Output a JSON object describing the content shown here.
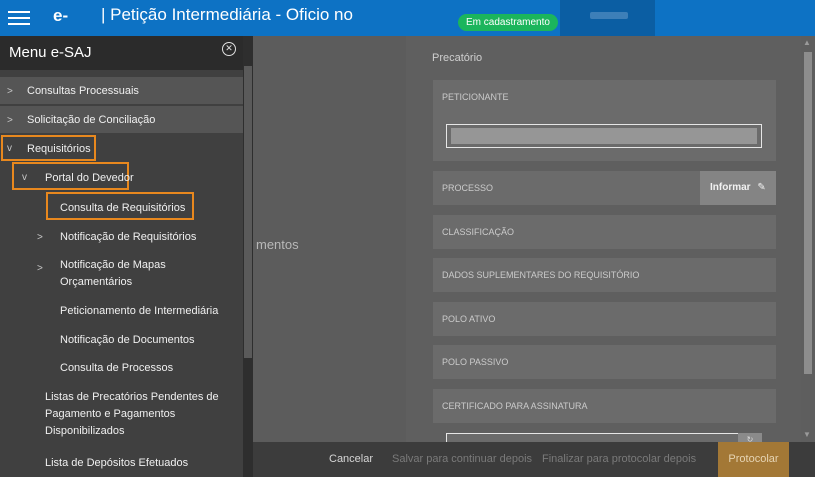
{
  "topbar": {
    "brand": "e-",
    "title": "| Petição Intermediária - Oficio no",
    "status_badge": "Em cadastramento"
  },
  "main": {
    "ghost_text": "mentos",
    "panel": {
      "title": "Precatório",
      "fields": {
        "peticionante": "PETICIONANTE",
        "processo": "PROCESSO",
        "classificacao": "CLASSIFICAÇÃO",
        "dados_suplementares": "DADOS SUPLEMENTARES DO REQUISITÓRIO",
        "polo_ativo": "POLO ATIVO",
        "polo_passivo": "POLO PASSIVO",
        "certificado": "CERTIFICADO PARA ASSINATURA"
      },
      "informar_label": "Informar",
      "pencil_icon": "✎",
      "refresh_icon": "↻"
    }
  },
  "footer": {
    "cancel": "Cancelar",
    "save": "Salvar para continuar depois",
    "finalize": "Finalizar para protocolar depois",
    "protocolar": "Protocolar"
  },
  "sidebar": {
    "title": "Menu e-SAJ",
    "close_icon": "✕",
    "items": {
      "consultas": "Consultas Processuais",
      "conciliacao": "Solicitação de Conciliação",
      "requisitorios": "Requisitórios",
      "portal": "Portal do Devedor",
      "consulta_req": "Consulta de Requisitórios",
      "notif_req": "Notificação de Requisitórios",
      "notif_mapas": "Notificação de Mapas Orçamentários",
      "peticionamento": "Peticionamento de Intermediária",
      "notif_docs": "Notificação de Documentos",
      "consulta_proc": "Consulta de Processos",
      "listas": "Listas de Precatórios Pendentes de Pagamento e Pagamentos Disponibilizados",
      "depositos": "Lista de Depósitos Efetuados"
    },
    "chevron_right": ">",
    "chevron_down": "v"
  },
  "colors": {
    "topbar": "#0d72c4",
    "badge": "#1bb55c",
    "highlight": "#e8881e",
    "protocolar": "#a37836"
  }
}
